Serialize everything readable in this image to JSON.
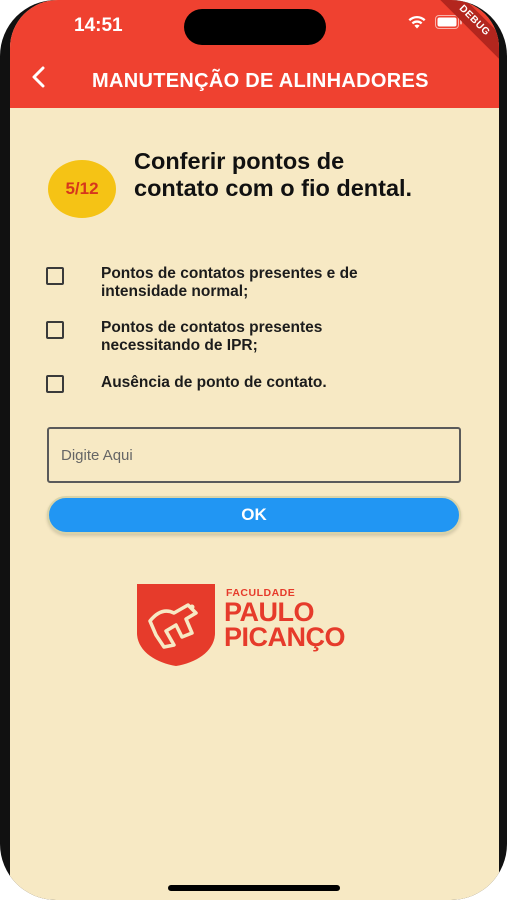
{
  "status_bar": {
    "time": "14:51",
    "debug_label": "DEBUG"
  },
  "app_bar": {
    "title": "MANUTENÇÃO DE ALINHADORES",
    "back_icon": "chevron-left-icon",
    "color": "#ef4130"
  },
  "question": {
    "progress": "5/12",
    "text": "Conferir pontos de contato com o fio dental."
  },
  "options": [
    {
      "label": "Pontos de contatos presentes e de intensidade normal;",
      "checked": false
    },
    {
      "label": "Pontos de contatos presentes necessitando de IPR;",
      "checked": false
    },
    {
      "label": "Ausência de ponto de contato.",
      "checked": false
    }
  ],
  "input": {
    "placeholder": "Digite Aqui",
    "value": ""
  },
  "ok_button": {
    "label": "OK",
    "color": "#2196f3"
  },
  "logo": {
    "small_text": "FACULDADE",
    "line1": "PAULO",
    "line2": "PICANÇO",
    "color": "#e63b2b"
  },
  "background_color": "#f7e9c4"
}
